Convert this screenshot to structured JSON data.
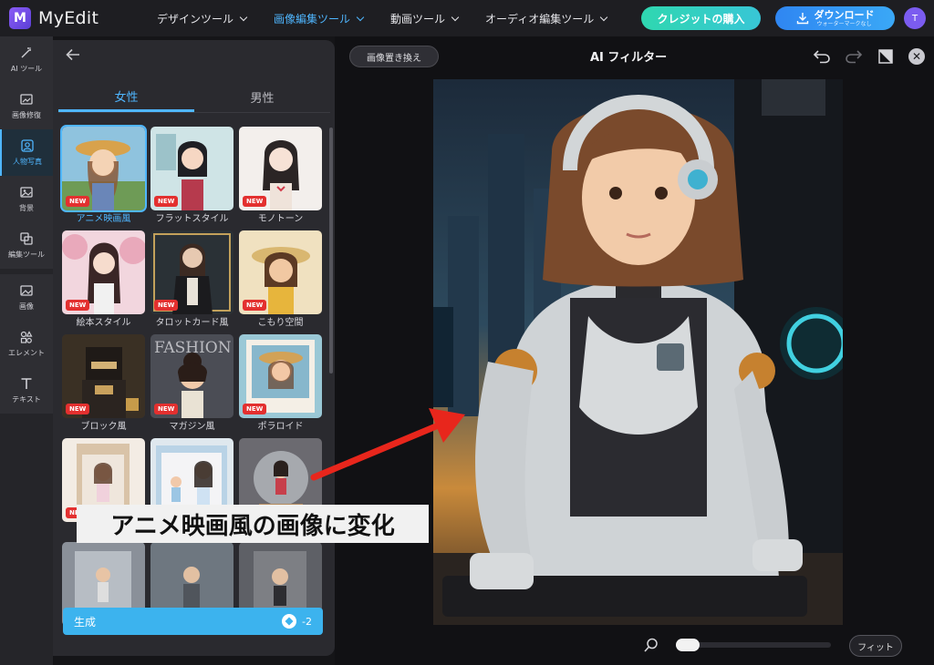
{
  "header": {
    "app_name": "MyEdit",
    "logo_letter": "M",
    "nav": [
      {
        "label": "デザインツール",
        "active": false
      },
      {
        "label": "画像編集ツール",
        "active": true
      },
      {
        "label": "動画ツール",
        "active": false
      },
      {
        "label": "オーディオ編集ツール",
        "active": false
      }
    ],
    "buy_credits_label": "クレジットの購入",
    "download_label": "ダウンロード",
    "download_sublabel": "ウォーターマークなし",
    "avatar_initial": "T",
    "accent_color": "#4fb6ff"
  },
  "rail": {
    "items": [
      {
        "label": "AI ツール",
        "icon": "magic-wand-icon"
      },
      {
        "label": "画像修復",
        "icon": "image-repair-icon"
      },
      {
        "label": "人物写真",
        "icon": "portrait-icon",
        "active": true
      },
      {
        "label": "背景",
        "icon": "background-icon"
      },
      {
        "label": "編集ツール",
        "icon": "edit-tools-icon"
      },
      {
        "label": "画像",
        "icon": "image-icon"
      },
      {
        "label": "エレメント",
        "icon": "elements-icon"
      },
      {
        "label": "テキスト",
        "icon": "text-icon"
      }
    ]
  },
  "panel": {
    "tabs": [
      {
        "label": "女性",
        "active": true
      },
      {
        "label": "男性",
        "active": false
      }
    ],
    "styles": [
      {
        "label": "アニメ映画風",
        "new": true,
        "selected": true
      },
      {
        "label": "フラットスタイル",
        "new": true
      },
      {
        "label": "モノトーン",
        "new": true
      },
      {
        "label": "絵本スタイル",
        "new": true
      },
      {
        "label": "タロットカード風",
        "new": true
      },
      {
        "label": "こもり空間",
        "new": true
      },
      {
        "label": "ブロック風",
        "new": true
      },
      {
        "label": "マガジン風",
        "new": true
      },
      {
        "label": "ポラロイド",
        "new": true
      },
      {
        "label": "",
        "new": true
      },
      {
        "label": "",
        "new": true
      },
      {
        "label": "",
        "new": false
      },
      {
        "label": "",
        "new": false
      },
      {
        "label": "",
        "new": false
      },
      {
        "label": "",
        "new": false
      }
    ],
    "new_badge": "NEW",
    "generate_label": "生成",
    "generate_cost": "-2"
  },
  "canvas": {
    "replace_button": "画像置き換え",
    "title": "AI フィルター",
    "fit_button": "フィット",
    "zoom_fraction": 0.0
  },
  "annotation": {
    "text": "アニメ映画風の画像に変化",
    "arrow_color": "#e8261c"
  }
}
